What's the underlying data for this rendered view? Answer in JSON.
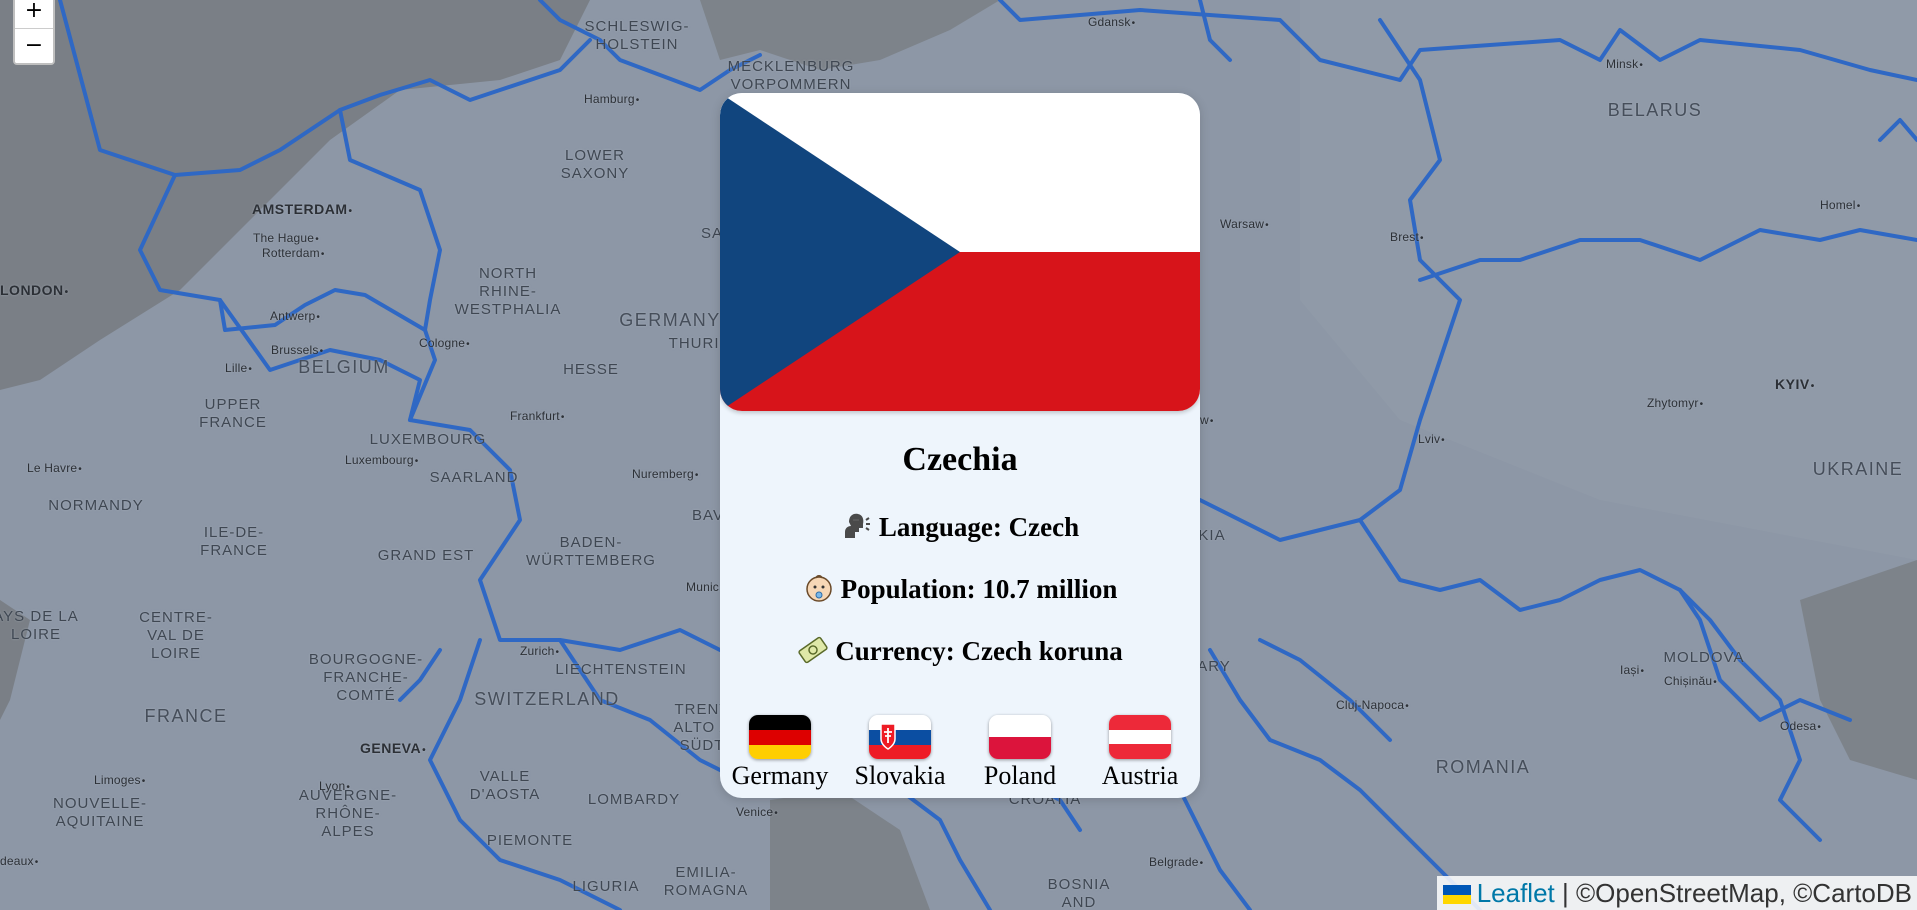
{
  "map": {
    "zoom_in_label": "+",
    "zoom_out_label": "−",
    "country_labels": [
      "SCHLESWIG-\nHOLSTEIN",
      "MECKLENBURG\nVORPOMMERN",
      "LOWER\nSAXONY",
      "NORTH\nRHINE-\nWESTPHALIA",
      "GERMANY",
      "HESSE",
      "BELGIUM",
      "LUXEMBOURG",
      "SAARLAND",
      "UPPER\nFRANCE",
      "NORMANDY",
      "ILE-DE-\nFRANCE",
      "GRAND EST",
      "BADEN-\nWÜRTTEMBERG",
      "CENTRE-\nVAL DE\nLOIRE",
      "BOURGOGNE-\nFRANCHE-\nCOMTÉ",
      "FRANCE",
      "SWITZERLAND",
      "LIECHTENSTEIN",
      "TRENT\nALTO A\nSÜDT",
      "VALLE\nD'AOSTA",
      "LOMBARDY",
      "NOUVELLE-\nAQUITAINE",
      "AUVERGNE-\nRHÔNE-\nALPES",
      "PIEMONTE",
      "EMILIA-\nROMAGNA",
      "LIGURIA",
      "PAYS DE LA\nLOIRE",
      "BELARUS",
      "UKRAINE",
      "MOLDOVA",
      "ROMANIA",
      "BOSNIA\nAND",
      "CROATIA",
      "THURIN",
      "BAV",
      "KIA",
      "ARY",
      "SA"
    ],
    "city_labels": [
      "Gdansk",
      "Hamburg",
      "Minsk",
      "AMSTERDAM",
      "The Hague",
      "Rotterdam",
      "LONDON",
      "Warsaw",
      "Brest",
      "Homel",
      "Antwerp",
      "Brussels",
      "Cologne",
      "Lille",
      "Frankfurt",
      "KYIV",
      "Zhytomyr",
      "Luxembourg",
      "Lviv",
      "Le Havre",
      "Nuremberg",
      "Zurich",
      "Munic",
      "Iași",
      "Chișinău",
      "Cluj-Napoca",
      "GENEVA",
      "Limoges",
      "Lyon",
      "Odesa",
      "Venice",
      "Belgrade",
      "deaux",
      "w"
    ]
  },
  "attribution": {
    "leaflet_label": "Leaflet",
    "rest": " | ©OpenStreetMap, ©CartoDB"
  },
  "card": {
    "country_name": "Czechia",
    "language_text": "Language: Czech",
    "population_text": "Population: 10.7 million",
    "currency_text": "Currency: Czech koruna",
    "flag_colors": {
      "blue": "#11457e",
      "white": "#ffffff",
      "red": "#d7141a"
    },
    "neighbors": [
      {
        "name": "Germany",
        "flag": "germany-flag"
      },
      {
        "name": "Slovakia",
        "flag": "slovakia-flag"
      },
      {
        "name": "Poland",
        "flag": "poland-flag"
      },
      {
        "name": "Austria",
        "flag": "austria-flag"
      }
    ]
  },
  "colors": {
    "map_background": "#8d97a6",
    "border_line": "#2f68c4",
    "card_background": "#eef5fc",
    "link": "#0078a8"
  }
}
